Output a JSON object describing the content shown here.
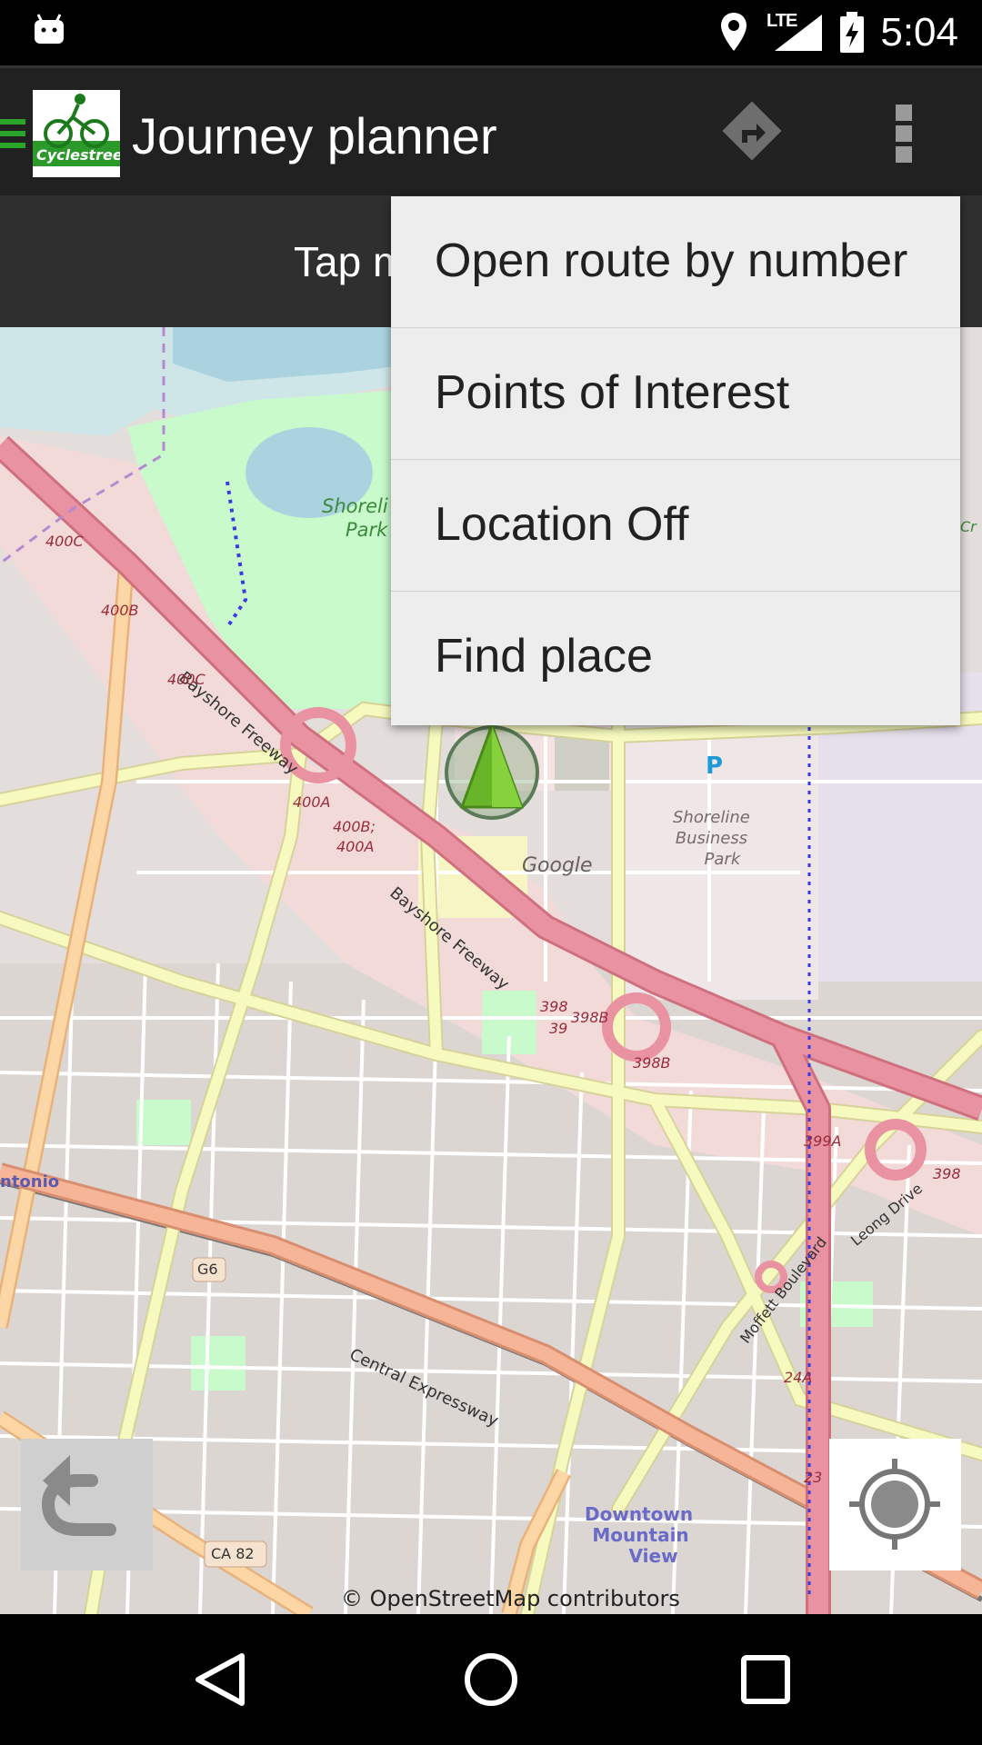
{
  "status_bar": {
    "time": "5:04",
    "network": "LTE",
    "icons": [
      "android-debug-icon",
      "location-pin-icon",
      "signal-icon",
      "battery-charging-icon"
    ]
  },
  "action_bar": {
    "title": "Journey planner",
    "logo_text": "Cyclestreets",
    "icons": [
      "drawer-menu-icon",
      "route-directions-icon",
      "overflow-menu-icon"
    ]
  },
  "hint_bar": {
    "text": "Tap m"
  },
  "overflow_menu": {
    "items": [
      {
        "label": "Open route by number"
      },
      {
        "label": "Points of Interest"
      },
      {
        "label": "Location Off"
      },
      {
        "label": "Find place"
      }
    ]
  },
  "map": {
    "attribution": "© OpenStreetMap contributors",
    "labels": {
      "shoreline_park": [
        "Shoreli",
        "Park"
      ],
      "shoreline_business_park": [
        "Shoreline",
        "Business",
        "Park"
      ],
      "google": "Google",
      "parking": "P",
      "downtown": [
        "Downtown",
        "Mountain",
        "View"
      ],
      "bayshore_1": "Bayshore Freeway",
      "bayshore_2": "Bayshore Freeway",
      "central_expressway": "Central Expressway",
      "moffett": "Moffett Boulevard",
      "leong": "Leong Drive",
      "antonio": "ntonio",
      "shield_g6": "G6",
      "shield_ca82": "CA 82",
      "exits": [
        "400C",
        "400B",
        "400C",
        "400A",
        "400B;",
        "400A",
        "398",
        "398B",
        "39",
        "398B",
        "399A",
        "398",
        "24A",
        "23"
      ],
      "edge_cr": "Cr"
    }
  },
  "colors": {
    "motorway": "#e892a2",
    "primary_road": "#f7fabf",
    "trunk": "#fcd6a4",
    "park": "#c8facc",
    "water": "#aad3df",
    "residential": "#e0dfdf",
    "commercial": "#f2dad9",
    "menu_bg": "#ededed",
    "action_bar_bg": "#212121"
  },
  "nav_bar": {
    "icons": [
      "back-icon",
      "home-icon",
      "recents-icon"
    ]
  }
}
